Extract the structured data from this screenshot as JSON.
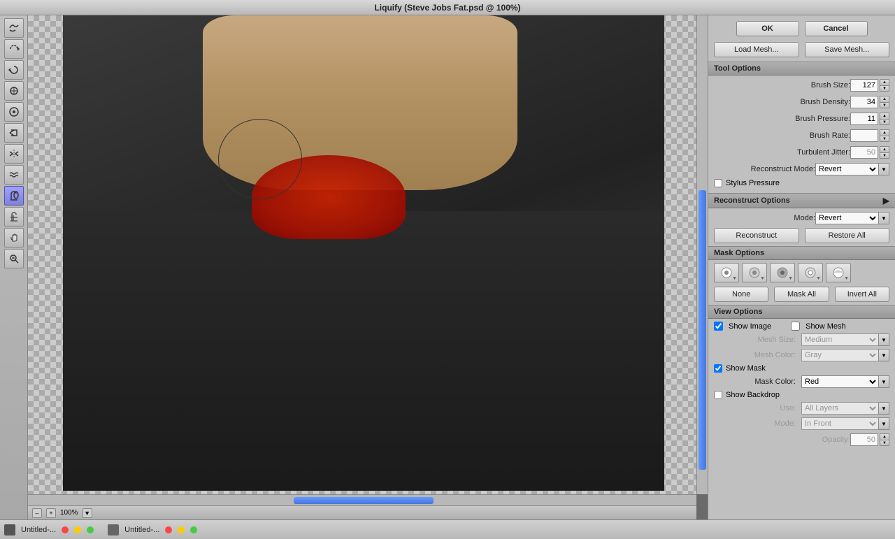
{
  "title": "Liquify (Steve Jobs Fat.psd @ 100%)",
  "toolbar": {
    "tools": [
      {
        "name": "warp",
        "icon": "↖",
        "active": false
      },
      {
        "name": "reconstruct",
        "icon": "↺",
        "active": false
      },
      {
        "name": "twirl-clockwise",
        "icon": "↻",
        "active": false
      },
      {
        "name": "pucker",
        "icon": "◉",
        "active": false
      },
      {
        "name": "bloat",
        "icon": "⊕",
        "active": false
      },
      {
        "name": "push-left",
        "icon": "←",
        "active": false
      },
      {
        "name": "mirror",
        "icon": "⟺",
        "active": false
      },
      {
        "name": "turbulence",
        "icon": "≈",
        "active": false
      },
      {
        "name": "freeze-mask",
        "icon": "✒",
        "active": true
      },
      {
        "name": "thaw-mask",
        "icon": "✏",
        "active": false
      },
      {
        "name": "hand",
        "icon": "✋",
        "active": false
      },
      {
        "name": "zoom",
        "icon": "🔍",
        "active": false
      }
    ]
  },
  "buttons": {
    "ok": "OK",
    "cancel": "Cancel",
    "load_mesh": "Load Mesh...",
    "save_mesh": "Save Mesh..."
  },
  "tool_options": {
    "section_label": "Tool Options",
    "brush_size_label": "Brush Size:",
    "brush_size_value": "127",
    "brush_density_label": "Brush Density:",
    "brush_density_value": "34",
    "brush_pressure_label": "Brush Pressure:",
    "brush_pressure_value": "11",
    "brush_rate_label": "Brush Rate:",
    "brush_rate_value": "",
    "turbulent_jitter_label": "Turbulent Jitter:",
    "turbulent_jitter_value": "50",
    "reconstruct_mode_label": "Reconstruct Mode:",
    "reconstruct_mode_value": "Revert",
    "stylus_pressure_label": "Stylus Pressure"
  },
  "reconstruct_options": {
    "section_label": "Reconstruct Options",
    "mode_label": "Mode:",
    "mode_value": "Revert",
    "reconstruct_btn": "Reconstruct",
    "restore_all_btn": "Restore All"
  },
  "mask_options": {
    "section_label": "Mask Options",
    "none_btn": "None",
    "mask_all_btn": "Mask All",
    "invert_all_btn": "Invert All"
  },
  "view_options": {
    "section_label": "View Options",
    "show_image_label": "Show Image",
    "show_mesh_label": "Show Mesh",
    "mesh_size_label": "Mesh Size:",
    "mesh_size_value": "Medium",
    "mesh_color_label": "Mesh Color:",
    "mesh_color_value": "Gray",
    "show_mask_label": "Show Mask",
    "mask_color_label": "Mask Color:",
    "mask_color_value": "Red",
    "show_backdrop_label": "Show Backdrop",
    "use_label": "Use:",
    "use_value": "All Layers",
    "mode_label": "Mode:",
    "mode_value": "In Front",
    "opacity_label": "Opacity:",
    "opacity_value": "50"
  },
  "statusbar": {
    "zoom_value": "100%"
  },
  "taskbar": {
    "item1": "Untitled-...",
    "item2": "Untitled-..."
  }
}
